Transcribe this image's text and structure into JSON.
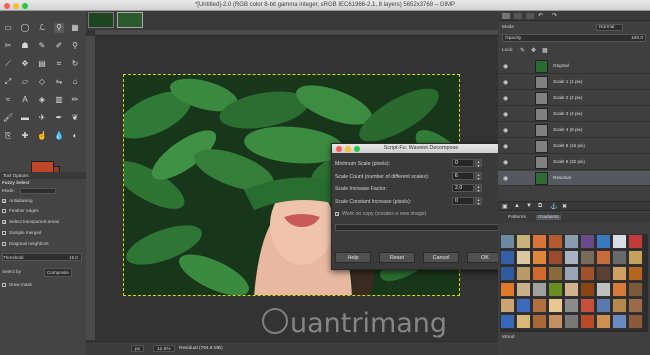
{
  "window": {
    "title": "*[Untitled]-2.0 (RGB color 8-bit gamma integer, sRGB IEC61966-2.1, 8 layers) 5652x3768 – GIMP"
  },
  "toolbox": {
    "tab_label": "Tool Options",
    "tool_name": "Fuzzy Select",
    "mode_label": "Mode:",
    "antialiasing": "Antialiasing",
    "feather_edges": "Feather edges",
    "select_transparent": "Select transparent areas",
    "sample_merged": "Sample merged",
    "diagonal_neighbors": "Diagonal neighbors",
    "threshold_label": "Threshold",
    "threshold_value": "15.0",
    "select_by_label": "Select by",
    "select_by_value": "Composite",
    "draw_mask": "Draw mask"
  },
  "status": {
    "unit": "px",
    "zoom": "12.5%",
    "layer_info": "Residual (794.8 MB)"
  },
  "dialog": {
    "title": "Script-Fu: Wavelet Decompose",
    "min_scale_label": "Minimum Scale (pixels):",
    "min_scale_value": "0",
    "scale_count_label": "Scale Count (number of different scales):",
    "scale_count_value": "6",
    "scale_factor_label": "Scale Increase Factor:",
    "scale_factor_value": "2.0",
    "scale_constant_label": "Scale Constant Increase (pixels):",
    "scale_constant_value": "0",
    "work_on_copy": "Work on copy (creates a new image)",
    "help": "Help",
    "reset": "Reset",
    "cancel": "Cancel",
    "ok": "OK"
  },
  "layers_panel": {
    "mode_label": "Mode",
    "mode_value": "Normal",
    "opacity_label": "Opacity",
    "opacity_value": "100.0",
    "lock_label": "Lock:",
    "layers": [
      {
        "name": "Original"
      },
      {
        "name": "Scale 1 (1 pix)"
      },
      {
        "name": "Scale 2 (2 pix)"
      },
      {
        "name": "Scale 3 (4 pix)"
      },
      {
        "name": "Scale 4 (8 pix)"
      },
      {
        "name": "Scale 5 (16 pix)"
      },
      {
        "name": "Scale 6 (32 pix)"
      },
      {
        "name": "Residual"
      }
    ],
    "patterns_tab": "Patterns",
    "gradients_tab": "Gradients",
    "pattern_name": "Wood"
  },
  "watermark": "uantrimang",
  "colors": {
    "accent": "#c0462a",
    "selection": "#d8d800"
  }
}
